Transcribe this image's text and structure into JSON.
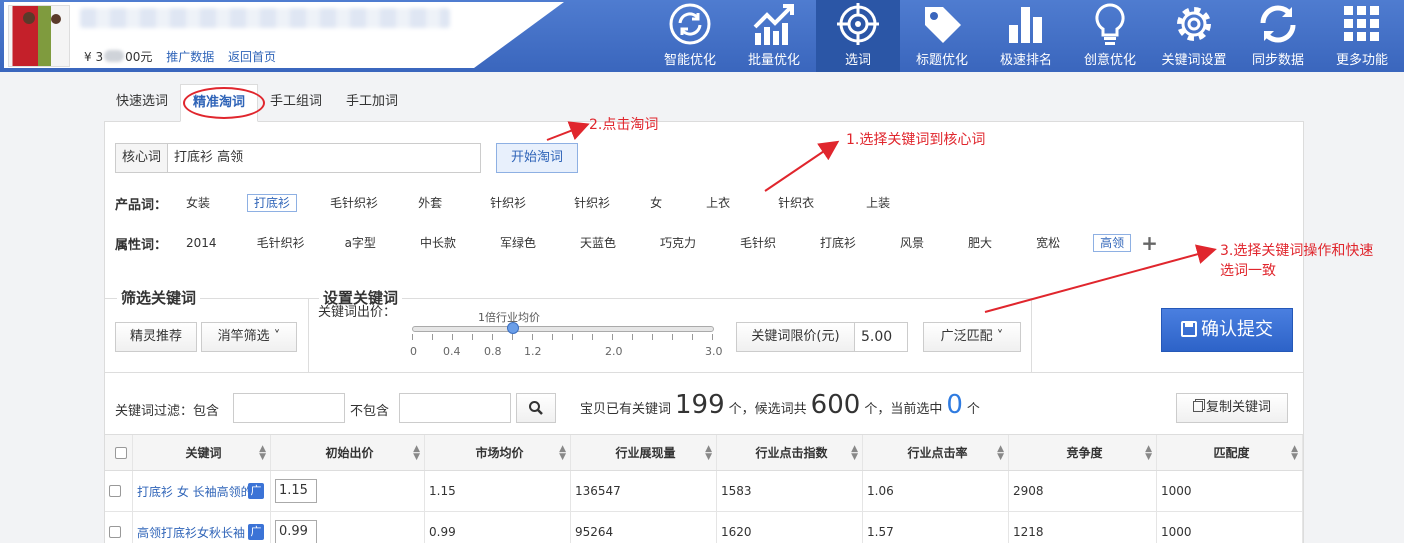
{
  "header": {
    "price_prefix": "¥ 3",
    "price_suffix": "00元",
    "promo_link": "推广数据",
    "home_link": "返回首页"
  },
  "nav": [
    {
      "label": "智能优化",
      "icon": "refresh-cycle-icon"
    },
    {
      "label": "批量优化",
      "icon": "trend-chart-icon"
    },
    {
      "label": "选词",
      "icon": "crosshair-icon",
      "active": true
    },
    {
      "label": "标题优化",
      "icon": "tag-icon"
    },
    {
      "label": "极速排名",
      "icon": "bar-chart-icon"
    },
    {
      "label": "创意优化",
      "icon": "lightbulb-icon"
    },
    {
      "label": "关键词设置",
      "icon": "gear-icon"
    },
    {
      "label": "同步数据",
      "icon": "sync-icon"
    },
    {
      "label": "更多功能",
      "icon": "grid-icon"
    }
  ],
  "tabs": [
    "快速选词",
    "精准淘词",
    "手工组词",
    "手工加词"
  ],
  "core": {
    "label": "核心词",
    "value": "打底衫 高领",
    "start_button": "开始淘词"
  },
  "product_words": {
    "label": "产品词：",
    "items": [
      "女装",
      "打底衫",
      "毛针织衫",
      "外套",
      "针织衫",
      "针织衫",
      "女",
      "上衣",
      "针织衣",
      "上装"
    ],
    "selected": [
      1
    ]
  },
  "attr_words": {
    "label": "属性词：",
    "items": [
      "2014",
      "毛针织衫",
      "a字型",
      "中长款",
      "军绿色",
      "天蓝色",
      "巧克力",
      "毛针织",
      "打底衫",
      "风景",
      "肥大",
      "宽松",
      "高领"
    ],
    "selected": [
      12
    ],
    "plus": "+"
  },
  "filter_section": {
    "title": "筛选关键词",
    "btn_recommend": "精灵推荐",
    "btn_filter": "消竿筛选 ˅"
  },
  "set_section": {
    "title": "设置关键词",
    "bid_label": "关键词出价：",
    "slider_caption": "1倍行业均价",
    "slider_value": 1.0,
    "slider_min": 0,
    "slider_max": 3.0,
    "ticks": [
      "0",
      "0.4",
      "0.8",
      "1.2",
      "2.0",
      "3.0"
    ],
    "limit_label": "关键词限价(元)",
    "limit_value": "5.00",
    "match_button": "广泛匹配 ˅"
  },
  "confirm_button": "确认提交",
  "filter_bar": {
    "label": "关键词过滤：包含",
    "exclude_label": "不包含",
    "stat_prefix": "宝贝已有关键词",
    "existing": "199",
    "stat_mid1": "个，候选词共",
    "candidates": "600",
    "stat_mid2": "个，当前选中",
    "selected": "0",
    "stat_suffix": "个",
    "copy_button": "复制关键词"
  },
  "table": {
    "headers": [
      "关键词",
      "初始出价",
      "市场均价",
      "行业展现量",
      "行业点击指数",
      "行业点击率",
      "竞争度",
      "匹配度"
    ],
    "rows": [
      {
        "keyword": "打底衫 女 长袖高领的",
        "bid": "1.15",
        "market": "1.15",
        "impressions": "136547",
        "click_index": "1583",
        "ctr": "1.06",
        "competition": "2908",
        "match": "1000"
      },
      {
        "keyword": "高领打底衫女秋长袖",
        "bid": "0.99",
        "market": "0.99",
        "impressions": "95264",
        "click_index": "1620",
        "ctr": "1.57",
        "competition": "1218",
        "match": "1000"
      }
    ],
    "badge": "广"
  },
  "annotations": {
    "a1": "1.选择关键词到核心词",
    "a2": "2.点击淘词",
    "a3_line1": "3.选择关键词操作和快速",
    "a3_line2": "选词一致"
  },
  "colors": {
    "header_blue": "#3a66bd",
    "active_nav": "#2b56a6",
    "link_blue": "#2f64b8",
    "annotation_red": "#e0262d"
  }
}
